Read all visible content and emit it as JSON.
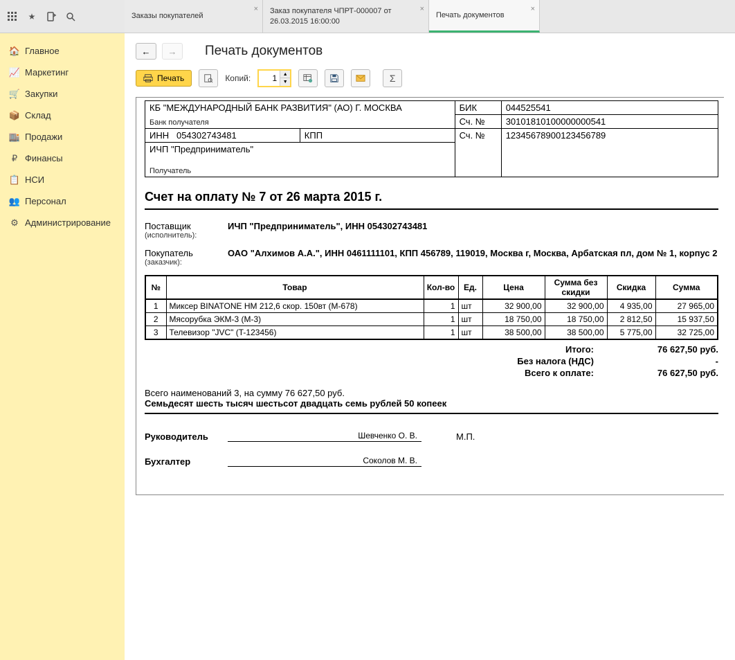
{
  "tabs": [
    {
      "label": "Заказы покупателей"
    },
    {
      "label": "Заказ покупателя ЧПРТ-000007 от 26.03.2015 16:00:00"
    },
    {
      "label": "Печать документов",
      "active": true
    }
  ],
  "sidebar": {
    "items": [
      {
        "label": "Главное"
      },
      {
        "label": "Маркетинг"
      },
      {
        "label": "Закупки"
      },
      {
        "label": "Склад"
      },
      {
        "label": "Продажи"
      },
      {
        "label": "Финансы"
      },
      {
        "label": "НСИ"
      },
      {
        "label": "Персонал"
      },
      {
        "label": "Администрирование"
      }
    ]
  },
  "page": {
    "title": "Печать документов"
  },
  "toolbar": {
    "print_label": "Печать",
    "copies_label": "Копий:",
    "copies_value": "1"
  },
  "doc": {
    "bank": {
      "bank_name": "КБ \"МЕЖДУНАРОДНЫЙ БАНК РАЗВИТИЯ\" (АО) Г. МОСКВА",
      "bank_recipient_lbl": "Банк получателя",
      "bik_lbl": "БИК",
      "bik": "044525541",
      "acc_lbl": "Сч. №",
      "corr_acc": "30101810100000000541",
      "inn_lbl": "ИНН",
      "inn": "054302743481",
      "kpp_lbl": "КПП",
      "kpp": "",
      "acc2_lbl": "Сч. №",
      "acc": "12345678900123456789",
      "recipient": "ИЧП \"Предприниматель\"",
      "recipient_lbl": "Получатель"
    },
    "title": "Счет на оплату № 7 от 26 марта 2015 г.",
    "supplier": {
      "lbl": "Поставщик",
      "sub": "(исполнитель):",
      "val": "ИЧП \"Предприниматель\", ИНН 054302743481"
    },
    "buyer": {
      "lbl": "Покупатель",
      "sub": "(заказчик):",
      "val": "ОАО \"Алхимов А.А.\", ИНН 0461111101, КПП 456789, 119019, Москва г, Москва, Арбатская пл, дом № 1, корпус 2"
    },
    "items_header": {
      "n": "№",
      "name": "Товар",
      "qty": "Кол-во",
      "unit": "Ед.",
      "price": "Цена",
      "sum_nd": "Сумма без скидки",
      "disc": "Скидка",
      "sum": "Сумма"
    },
    "items": [
      {
        "n": "1",
        "name": "Миксер BINATONE HM 212,6 скор. 150вт (M-678)",
        "qty": "1",
        "unit": "шт",
        "price": "32 900,00",
        "sum_nd": "32 900,00",
        "disc": "4 935,00",
        "sum": "27 965,00"
      },
      {
        "n": "2",
        "name": "Мясорубка ЭКМ-3 (M-3)",
        "qty": "1",
        "unit": "шт",
        "price": "18 750,00",
        "sum_nd": "18 750,00",
        "disc": "2 812,50",
        "sum": "15 937,50"
      },
      {
        "n": "3",
        "name": "Телевизор \"JVC\" (T-123456)",
        "qty": "1",
        "unit": "шт",
        "price": "38 500,00",
        "sum_nd": "38 500,00",
        "disc": "5 775,00",
        "sum": "32 725,00"
      }
    ],
    "totals": {
      "itogo_lbl": "Итого:",
      "itogo": "76 627,50 руб.",
      "novat_lbl": "Без налога (НДС)",
      "novat": "-",
      "topay_lbl": "Всего к оплате:",
      "topay": "76 627,50 руб."
    },
    "summary_line": "Всего наименований 3, на сумму 76 627,50 руб.",
    "summary_words": "Семьдесят шесть тысяч шестьсот двадцать семь рублей 50 копеек",
    "signs": {
      "head_lbl": "Руководитель",
      "head_name": "Шевченко О. В.",
      "acc_lbl": "Бухгалтер",
      "acc_name": "Соколов М. В.",
      "mp": "М.П."
    }
  }
}
